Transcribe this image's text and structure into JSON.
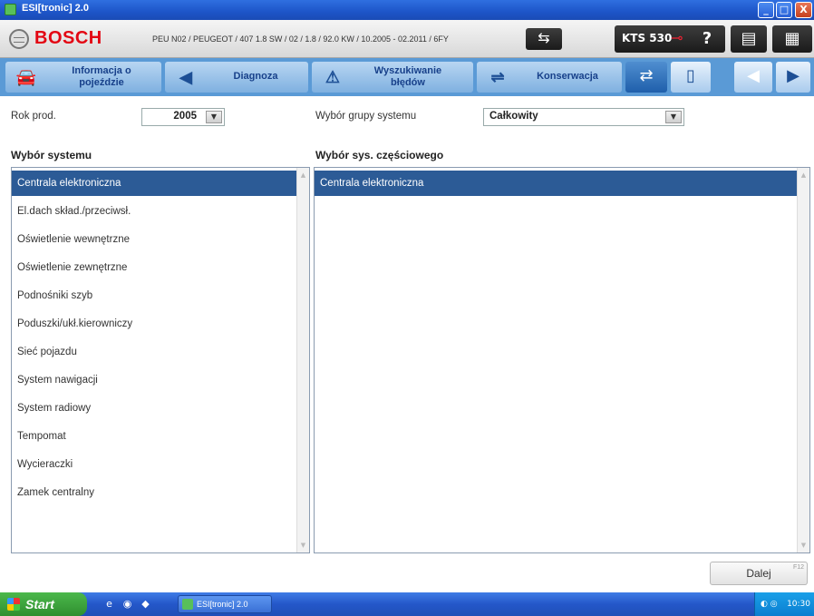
{
  "window": {
    "title": "ESI[tronic] 2.0",
    "minimize": "_",
    "maximize": "□",
    "close": "X"
  },
  "header": {
    "brand": "BOSCH",
    "vehicle": "PEU N02 / PEUGEOT / 407 1.8 SW / 02 / 1.8 / 92.0 KW / 10.2005 - 02.2011 / 6FY",
    "connect_icon": "⇆",
    "device": "KTS 530",
    "device_icon": "⊸",
    "help": "?",
    "print": "▤",
    "menu": "▦"
  },
  "tabs": [
    {
      "label": "Informacja o\npojeździe",
      "icon": "car-info-icon",
      "glyph": "🚘"
    },
    {
      "label": "Diagnoza",
      "icon": "diagnosis-icon",
      "glyph": "◀"
    },
    {
      "label": "Wyszukiwanie\nbłędów",
      "icon": "error-search-icon",
      "glyph": "⚠"
    },
    {
      "label": "Konserwacja",
      "icon": "maintenance-icon",
      "glyph": "⇌"
    }
  ],
  "toolbar": {
    "compare": "⇄",
    "book": "▯",
    "back": "◀",
    "forward": "▶"
  },
  "filters": {
    "year_label": "Rok prod.",
    "year_value": "2005",
    "group_label": "Wybór grupy systemu",
    "group_value": "Całkowity"
  },
  "systems": {
    "title": "Wybór systemu",
    "items": [
      "Centrala elektroniczna",
      "El.dach skład./przeciwsł.",
      "Oświetlenie wewnętrzne",
      "Oświetlenie zewnętrzne",
      "Podnośniki szyb",
      "Poduszki/ukł.kierowniczy",
      "Sieć pojazdu",
      "System nawigacji",
      "System radiowy",
      "Tempomat",
      "Wycieraczki",
      "Zamek centralny"
    ],
    "selected": "Centrala elektroniczna"
  },
  "subsystems": {
    "title": "Wybór sys. częściowego",
    "items": [
      "Centrala elektroniczna"
    ],
    "selected": "Centrala elektroniczna"
  },
  "footer": {
    "next_label": "Dalej",
    "next_key": "F12"
  },
  "taskbar": {
    "start_label": "Start",
    "task_label": "ESI[tronic] 2.0",
    "clock": "10:30"
  }
}
